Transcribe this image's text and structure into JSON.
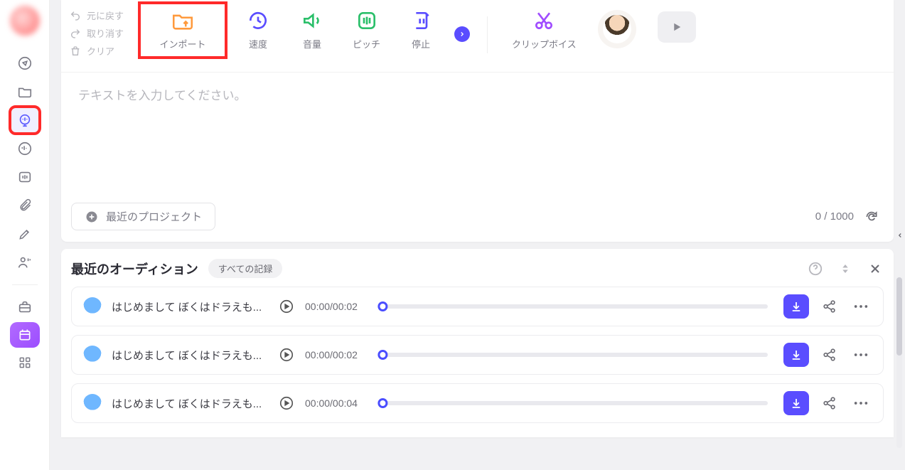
{
  "history": {
    "undo": "元に戻す",
    "redo": "取り消す",
    "clear": "クリア"
  },
  "toolbar": {
    "import": "インポート",
    "speed": "速度",
    "volume": "音量",
    "pitch": "ピッチ",
    "pause": "停止",
    "clip_voice": "クリップボイス"
  },
  "editor": {
    "placeholder": "テキストを入力してください。"
  },
  "recent_project_button": "最近のプロジェクト",
  "counter": {
    "current": "0",
    "sep": " / ",
    "max": "1000"
  },
  "auditions": {
    "title": "最近のオーディション",
    "all_records": "すべての記録",
    "rows": [
      {
        "title": "はじめまして ぼくはドラえも...",
        "time": "00:00/00:02"
      },
      {
        "title": "はじめまして ぼくはドラえも...",
        "time": "00:00/00:02"
      },
      {
        "title": "はじめまして ぼくはドラえも...",
        "time": "00:00/00:04"
      }
    ]
  },
  "colors": {
    "accent": "#5a4dff",
    "orange": "#ff9a3d",
    "green": "#2bbf6a",
    "highlight_red": "#ff2a2a"
  }
}
